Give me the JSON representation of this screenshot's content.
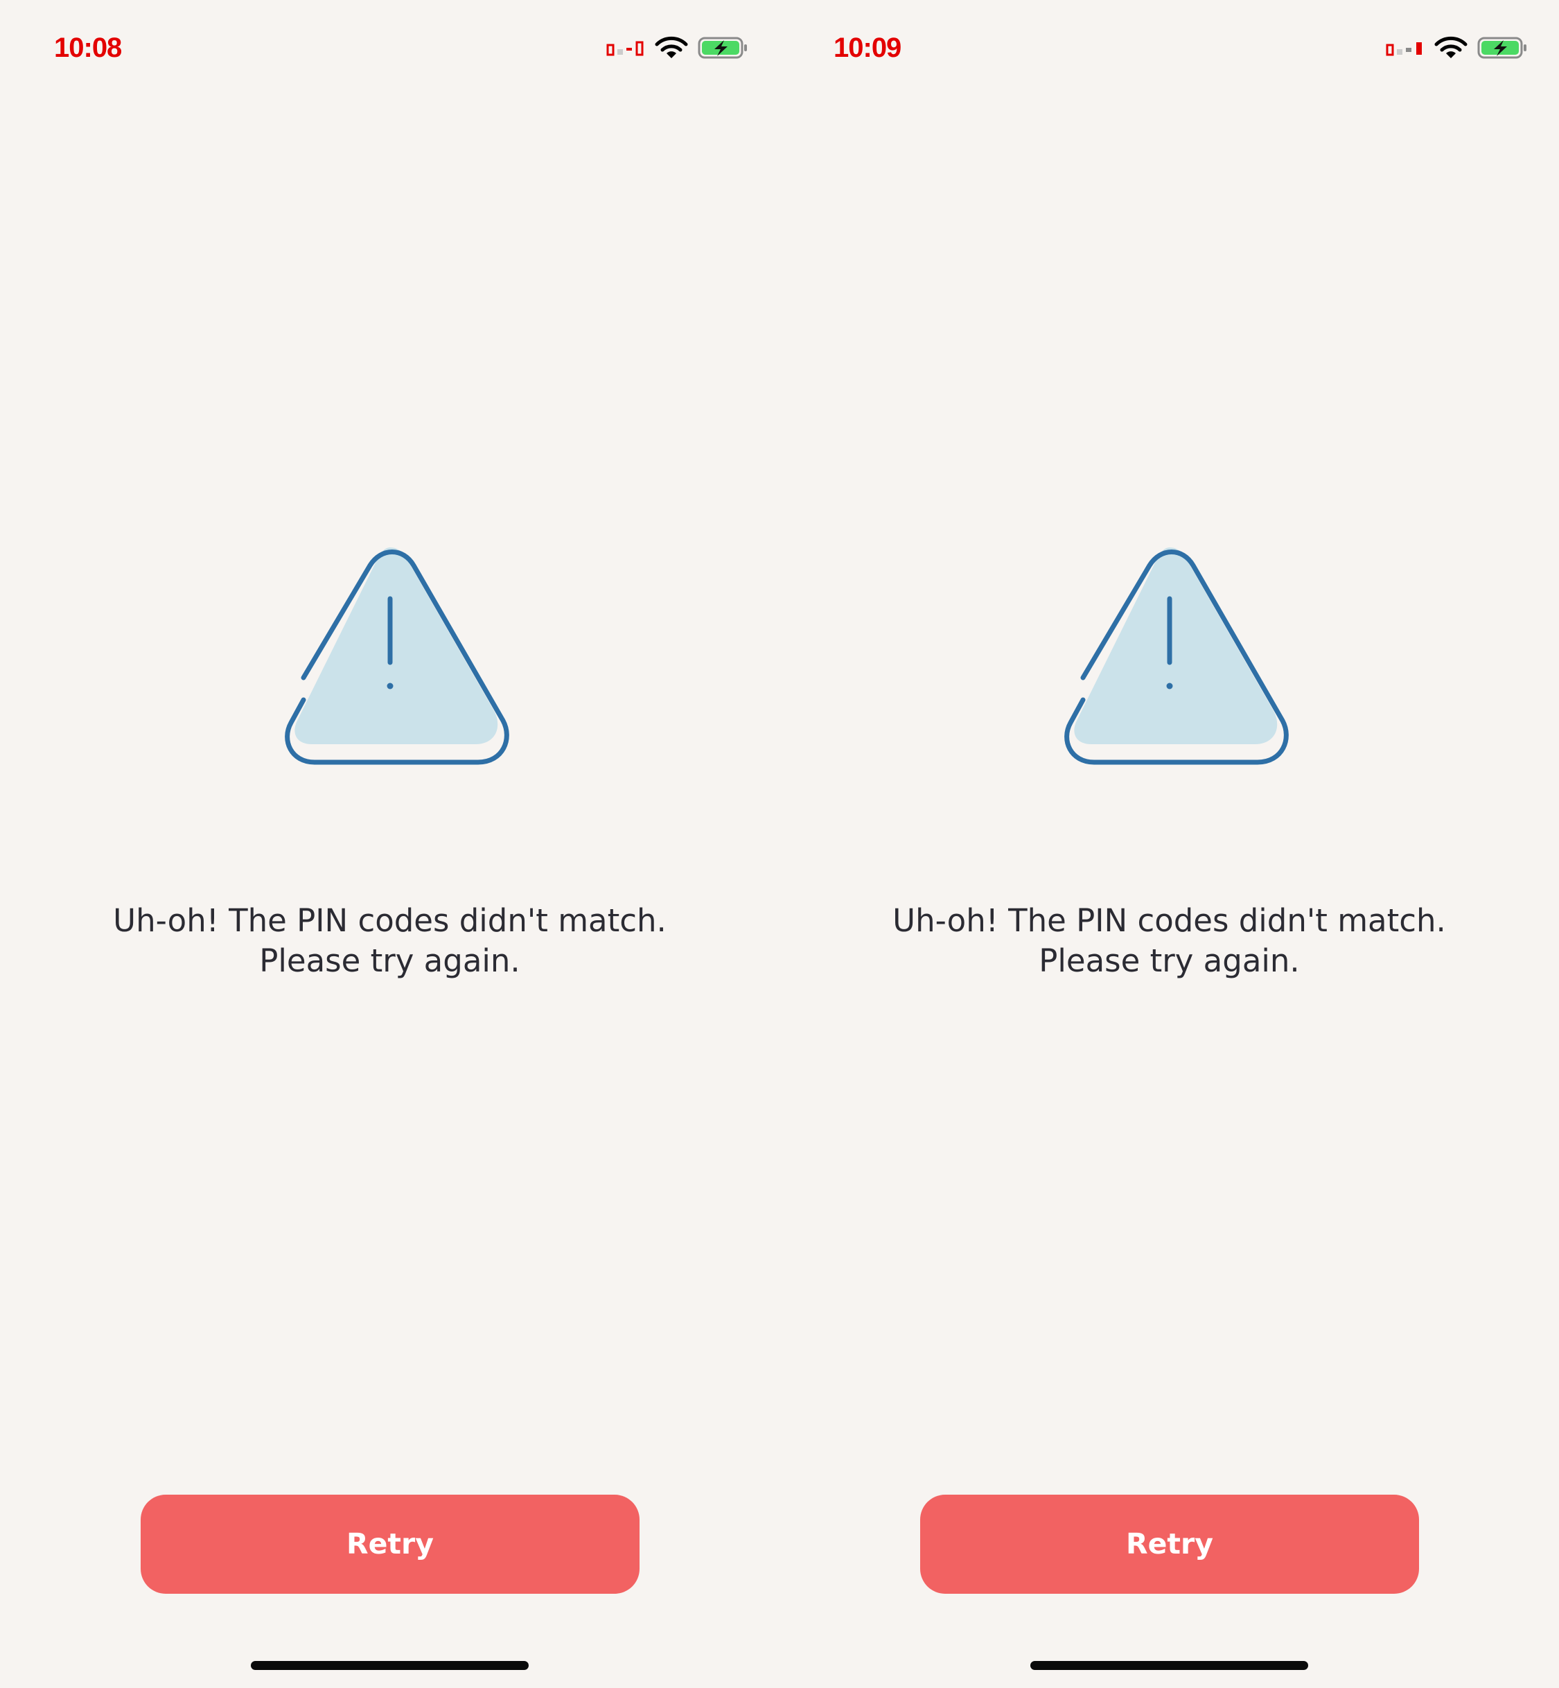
{
  "screens": [
    {
      "status_bar": {
        "time": "10:08"
      },
      "alert": {
        "message": "Uh-oh! The PIN codes didn't match. Please try again."
      },
      "actions": {
        "retry_label": "Retry"
      }
    },
    {
      "status_bar": {
        "time": "10:09"
      },
      "alert": {
        "message": "Uh-oh! The PIN codes didn't match. Please try again."
      },
      "actions": {
        "retry_label": "Retry"
      }
    }
  ],
  "icons": {
    "signal": "cellular-signal-icon",
    "wifi": "wifi-icon",
    "battery": "battery-charging-icon",
    "warning": "warning-triangle-icon"
  },
  "colors": {
    "background": "#f7f4f1",
    "accent": "#f26262",
    "icon_stroke": "#2e6fa6",
    "icon_fill": "#cbe2ea",
    "text": "#2b2b33",
    "battery_green": "#4cd964",
    "status_time": "#e30000"
  }
}
